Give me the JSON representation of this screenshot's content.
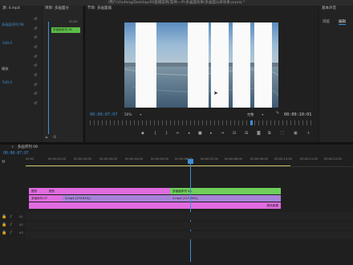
{
  "title_bar": "/用户/chufeng/Desktop/00直播案例/案例一/Pr多画面效果/多画面分屏效果.prproj *",
  "effect_controls": {
    "header": "源: 4.mp4",
    "right_header": "序列01",
    "rows": [
      {
        "label": "",
        "value": ""
      },
      {
        "label": "多画面序列 08",
        "value": ""
      },
      {
        "label": "",
        "value": "540.0"
      },
      {
        "label": "",
        "value": ""
      },
      {
        "label": "模拟",
        "value": ""
      },
      {
        "label": "",
        "value": "540.0"
      }
    ]
  },
  "mini_timeline": {
    "header": "项目: 多画面分",
    "time": "00;00",
    "clip_label": "多画面序列 08"
  },
  "program_monitor": {
    "header": "节目: 多画面器",
    "timecode_current": "00:00:07:07",
    "zoom": "50%",
    "quality": "完整",
    "timecode_total": "00:00:10:01"
  },
  "right_panel": {
    "header": "基本声音",
    "tab1": "浏览",
    "tab2": "编辑"
  },
  "timeline": {
    "header": "多画序列 08",
    "timecode": "00:00:07:07",
    "ruler": [
      "00:00",
      "00:00:01:00",
      "00:00:02:00",
      "00:00:03:00",
      "00:00:04:00",
      "00:00:05:00",
      "00:00:06:00",
      "00:00:07:00",
      "00:00:08:00",
      "00:00:09:00",
      "00:00:10:00",
      "00:00:11:00",
      "00:00:12:00"
    ],
    "clips": {
      "v3_a": "图形",
      "v3_b": "图形",
      "v3_c": "多画面序列 08",
      "v2_a": "多画序列 07",
      "v2_b": "3.mp4 [179.61%]",
      "v2_c": "4.mp4 [127.98%]",
      "v1_label": "颜色遮罩"
    },
    "track_labels": [
      "V3",
      "V2",
      "V1",
      "A1",
      "A2",
      "A3"
    ]
  },
  "colors": {
    "accent_blue": "#3f8fd6",
    "clip_pink": "#e06ce0",
    "clip_lavender": "#a782d8",
    "clip_green": "#6fcf5a",
    "bg": "#1d1d1d"
  }
}
